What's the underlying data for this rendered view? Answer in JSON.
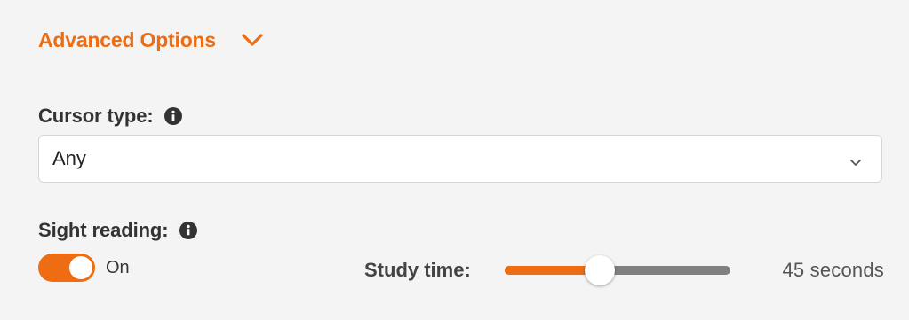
{
  "advanced": {
    "label": "Advanced Options",
    "icon": "chevron-down-icon",
    "expanded": true
  },
  "cursor": {
    "label": "Cursor type:",
    "info_icon": "info-icon",
    "selected": "Any"
  },
  "sight_reading": {
    "label": "Sight reading:",
    "info_icon": "info-icon",
    "toggle_on": true,
    "toggle_text": "On"
  },
  "study_time": {
    "label": "Study time:",
    "value_text": "45 seconds",
    "slider_fraction": 0.42
  },
  "colors": {
    "accent": "#ee6d12",
    "track": "#808080",
    "background": "#f4f4f4"
  }
}
